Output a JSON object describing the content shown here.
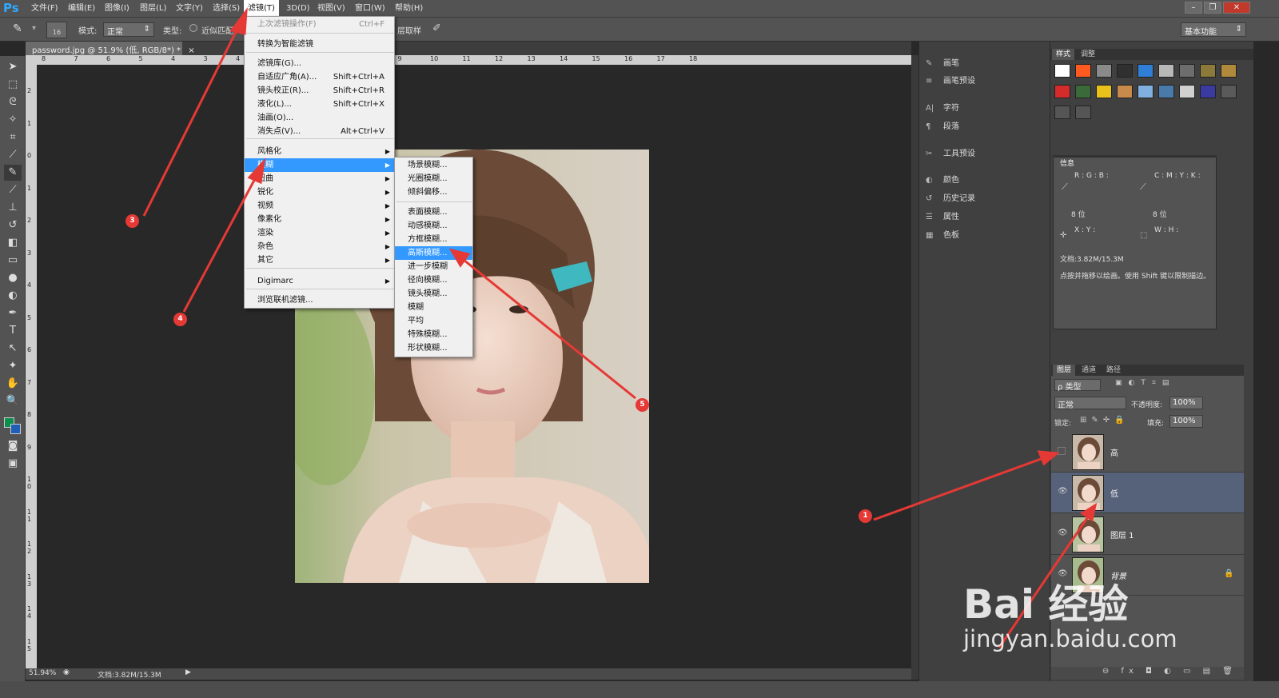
{
  "app": {
    "logo": "Ps"
  },
  "menubar": {
    "items": [
      "文件(F)",
      "编辑(E)",
      "图像(I)",
      "图层(L)",
      "文字(Y)",
      "选择(S)",
      "滤镜(T)",
      "3D(D)",
      "视图(V)",
      "窗口(W)",
      "帮助(H)"
    ]
  },
  "window": {
    "min": "–",
    "restore": "❐",
    "close": "✕"
  },
  "options": {
    "brush_size": "16",
    "mode_label": "模式:",
    "mode_value": "正常",
    "type_label": "类型:",
    "type_option": "近似匹配",
    "sample_label": "层取样",
    "workspace": "基本功能"
  },
  "document": {
    "tab": "password.jpg @ 51.9% (低, RGB/8*) *",
    "tab_close": "×",
    "zoom": "51.94%",
    "docsize": "文档:3.82M/15.3M"
  },
  "ruler": {
    "h_ticks": [
      "8",
      "7",
      "6",
      "5",
      "4",
      "3",
      "4",
      "5",
      "6",
      "7",
      "8",
      "9",
      "10",
      "11",
      "12",
      "13",
      "14",
      "15",
      "16",
      "17",
      "18"
    ],
    "v_ticks": [
      "2",
      "1",
      "0",
      "1",
      "2",
      "3",
      "4",
      "5",
      "6",
      "7",
      "8",
      "9",
      "1 0",
      "1 1",
      "1 2",
      "1 3",
      "1 4",
      "1 5"
    ]
  },
  "filter_menu": {
    "items": [
      {
        "label": "上次滤镜操作(F)",
        "shortcut": "Ctrl+F",
        "disabled": true
      },
      {
        "label": "转换为智能滤镜"
      },
      {
        "label": "滤镜库(G)..."
      },
      {
        "label": "自适应广角(A)...",
        "shortcut": "Shift+Ctrl+A"
      },
      {
        "label": "镜头校正(R)...",
        "shortcut": "Shift+Ctrl+R"
      },
      {
        "label": "液化(L)...",
        "shortcut": "Shift+Ctrl+X"
      },
      {
        "label": "油画(O)..."
      },
      {
        "label": "消失点(V)...",
        "shortcut": "Alt+Ctrl+V"
      },
      {
        "label": "风格化",
        "submenu": true
      },
      {
        "label": "模糊",
        "submenu": true,
        "highlight": true
      },
      {
        "label": "扭曲",
        "submenu": true
      },
      {
        "label": "锐化",
        "submenu": true
      },
      {
        "label": "视频",
        "submenu": true
      },
      {
        "label": "像素化",
        "submenu": true
      },
      {
        "label": "渲染",
        "submenu": true
      },
      {
        "label": "杂色",
        "submenu": true
      },
      {
        "label": "其它",
        "submenu": true
      },
      {
        "label": "Digimarc",
        "submenu": true
      },
      {
        "label": "浏览联机滤镜..."
      }
    ]
  },
  "blur_submenu": {
    "items": [
      "场景模糊...",
      "光圈模糊...",
      "倾斜偏移...",
      "表面模糊...",
      "动感模糊...",
      "方框模糊...",
      "高斯模糊...",
      "进一步模糊",
      "径向模糊...",
      "镜头模糊...",
      "模糊",
      "平均",
      "特殊模糊...",
      "形状模糊..."
    ],
    "highlight_index": 6
  },
  "mid_panel": {
    "items": [
      {
        "icon": "brush-icon",
        "label": "画笔"
      },
      {
        "icon": "brush-preset-icon",
        "label": "画笔预设"
      },
      {
        "icon": "character-icon",
        "label": "字符"
      },
      {
        "icon": "paragraph-icon",
        "label": "段落"
      },
      {
        "icon": "tool-preset-icon",
        "label": "工具预设"
      },
      {
        "icon": "color-icon",
        "label": "颜色"
      },
      {
        "icon": "history-icon",
        "label": "历史记录"
      },
      {
        "icon": "properties-icon",
        "label": "属性"
      },
      {
        "icon": "swatches-icon",
        "label": "色板"
      }
    ]
  },
  "styles_panel": {
    "tabs": [
      "样式",
      "调整"
    ],
    "swatches": [
      "#ffffff",
      "#ff5a1f",
      "#8a8a8a",
      "#303030",
      "#2f7fd6",
      "#b8b8b8",
      "#6d6d6d",
      "#8b7a3a",
      "#b08a3a",
      "#d62b2b",
      "#3a6a3a",
      "#e8c21a",
      "#c88a4a",
      "#7fb0e0",
      "#4a7aaa",
      "#d0d0d0",
      "#3a3aa0",
      "#5a5a5a",
      "#555555",
      "#555555"
    ]
  },
  "info_panel": {
    "title": "信息",
    "rgb": "R :\nG :\nB :",
    "cmyk": "C :\nM :\nY :\nK :",
    "bits_left": "8 位",
    "bits_right": "8 位",
    "xy": "X :\nY :",
    "wh": "W :\nH :",
    "docsize": "文档:3.82M/15.3M",
    "hint": "点按并拖移以绘画。使用 Shift 键以限制描边。"
  },
  "layers_panel": {
    "tabs": [
      "图层",
      "通道",
      "路径"
    ],
    "filter": "ρ 类型",
    "blend": "正常",
    "opacity_label": "不透明度:",
    "opacity": "100%",
    "lock_label": "锁定:",
    "fill_label": "填充:",
    "fill": "100%",
    "layers": [
      {
        "name": "高",
        "visible": false,
        "selected": false,
        "italic": false
      },
      {
        "name": "低",
        "visible": true,
        "selected": true,
        "italic": false
      },
      {
        "name": "图层 1",
        "visible": true,
        "selected": false,
        "italic": false
      },
      {
        "name": "背景",
        "visible": true,
        "selected": false,
        "italic": true,
        "locked": true
      }
    ],
    "eye": "👁",
    "lock_icon": "🔒",
    "footer": "⊖ fx ◘ ◐ ▭ ▤ 🗑"
  },
  "annotations": {
    "labels": [
      "1",
      "3",
      "4",
      "5"
    ],
    "arrow_color": "#e53935"
  },
  "watermark": {
    "brand": "Bai 经验",
    "url": "jingyan.baidu.com"
  }
}
